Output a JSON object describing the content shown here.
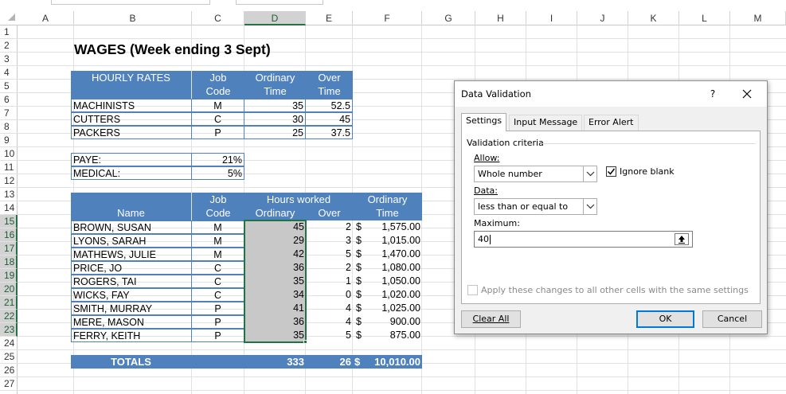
{
  "columns": [
    "A",
    "B",
    "C",
    "D",
    "E",
    "F",
    "G",
    "H",
    "I",
    "J",
    "K",
    "L",
    "M"
  ],
  "rows": [
    "1",
    "2",
    "3",
    "4",
    "5",
    "6",
    "7",
    "8",
    "9",
    "10",
    "11",
    "12",
    "13",
    "14",
    "15",
    "16",
    "17",
    "18",
    "19",
    "20",
    "21",
    "22",
    "23",
    "24",
    "25",
    "26",
    "27"
  ],
  "title": "WAGES (Week ending 3 Sept)",
  "rates": {
    "h_hourly": "HOURLY RATES",
    "h_job1": "Job",
    "h_job2": "Code",
    "h_ord1": "Ordinary",
    "h_ord2": "Time",
    "h_over1": "Over",
    "h_over2": "Time",
    "rows": [
      {
        "name": "MACHINISTS",
        "code": "M",
        "ord": "35",
        "over": "52.5"
      },
      {
        "name": "CUTTERS",
        "code": "C",
        "ord": "30",
        "over": "45"
      },
      {
        "name": "PACKERS",
        "code": "P",
        "ord": "25",
        "over": "37.5"
      }
    ]
  },
  "deductions": [
    {
      "label": "PAYE:",
      "value": "21%"
    },
    {
      "label": "MEDICAL:",
      "value": "5%"
    }
  ],
  "wages": {
    "h_job1": "Job",
    "h_job2": "Code",
    "h_hours": "Hours worked",
    "h_name": "Name",
    "h_ord": "Ordinary",
    "h_over": "Over",
    "h_otime1": "Ordinary",
    "h_otime2": "Time",
    "rows": [
      {
        "name": "BROWN, SUSAN",
        "code": "M",
        "ord": "45",
        "over": "2",
        "cur": "$",
        "amt": "1,575.00"
      },
      {
        "name": "LYONS, SARAH",
        "code": "M",
        "ord": "29",
        "over": "3",
        "cur": "$",
        "amt": "1,015.00"
      },
      {
        "name": "MATHEWS, JULIE",
        "code": "M",
        "ord": "42",
        "over": "5",
        "cur": "$",
        "amt": "1,470.00"
      },
      {
        "name": "PRICE, JO",
        "code": "C",
        "ord": "36",
        "over": "2",
        "cur": "$",
        "amt": "1,080.00"
      },
      {
        "name": "ROGERS, TAI",
        "code": "C",
        "ord": "35",
        "over": "1",
        "cur": "$",
        "amt": "1,050.00"
      },
      {
        "name": "WICKS, FAY",
        "code": "C",
        "ord": "34",
        "over": "0",
        "cur": "$",
        "amt": "1,020.00"
      },
      {
        "name": "SMITH, MURRAY",
        "code": "P",
        "ord": "41",
        "over": "4",
        "cur": "$",
        "amt": "1,025.00"
      },
      {
        "name": "MERE, MASON",
        "code": "P",
        "ord": "36",
        "over": "4",
        "cur": "$",
        "amt": "900.00"
      },
      {
        "name": "FERRY, KEITH",
        "code": "P",
        "ord": "35",
        "over": "5",
        "cur": "$",
        "amt": "875.00"
      }
    ],
    "totals": {
      "label": "TOTALS",
      "ord": "333",
      "over": "26",
      "cur": "$",
      "amt": "10,010.00"
    }
  },
  "dialog": {
    "title": "Data Validation",
    "help": "?",
    "tabs": [
      "Settings",
      "Input Message",
      "Error Alert"
    ],
    "section": "Validation criteria",
    "allow_label": "Allow:",
    "allow_value": "Whole number",
    "ignore_blank": "Ignore blank",
    "ignore_blank_checked": true,
    "data_label": "Data:",
    "data_value": "less than or equal to",
    "max_label": "Maximum:",
    "max_value": "40",
    "apply_all": "Apply these changes to all other cells with the same settings",
    "clear_all": "Clear All",
    "ok": "OK",
    "cancel": "Cancel"
  },
  "colors": {
    "header_blue": "#4f81bd",
    "selection_green": "#217346",
    "selected_fill": "#c8c8c8"
  }
}
